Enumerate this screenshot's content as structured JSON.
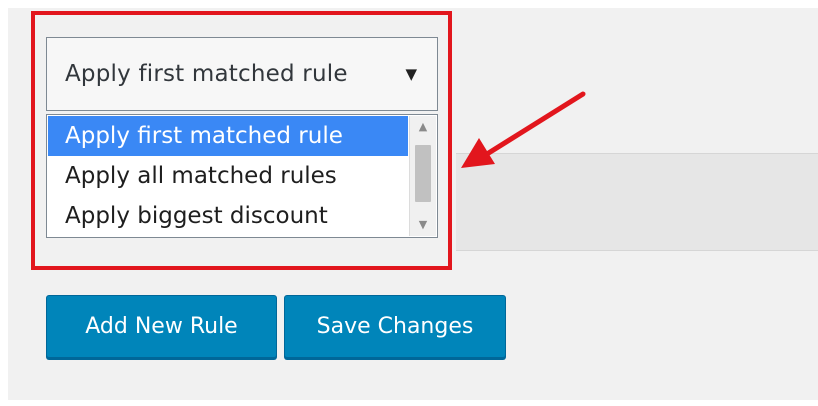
{
  "dropdown": {
    "selected_value": "Apply first matched rule",
    "options": [
      {
        "label": "Apply first matched rule",
        "selected": true
      },
      {
        "label": "Apply all matched rules",
        "selected": false
      },
      {
        "label": "Apply biggest discount",
        "selected": false
      }
    ]
  },
  "buttons": {
    "add_new_rule": "Add New Rule",
    "save_changes": "Save Changes"
  },
  "colors": {
    "highlight": "#e2161d",
    "selected_option": "#3a88f5",
    "button": "#0085ba"
  },
  "icons": {
    "dropdown_arrow": "triangle-down",
    "scroll_up": "triangle-up",
    "scroll_down": "triangle-down",
    "annotation_arrow": "red-arrow-pointer"
  }
}
